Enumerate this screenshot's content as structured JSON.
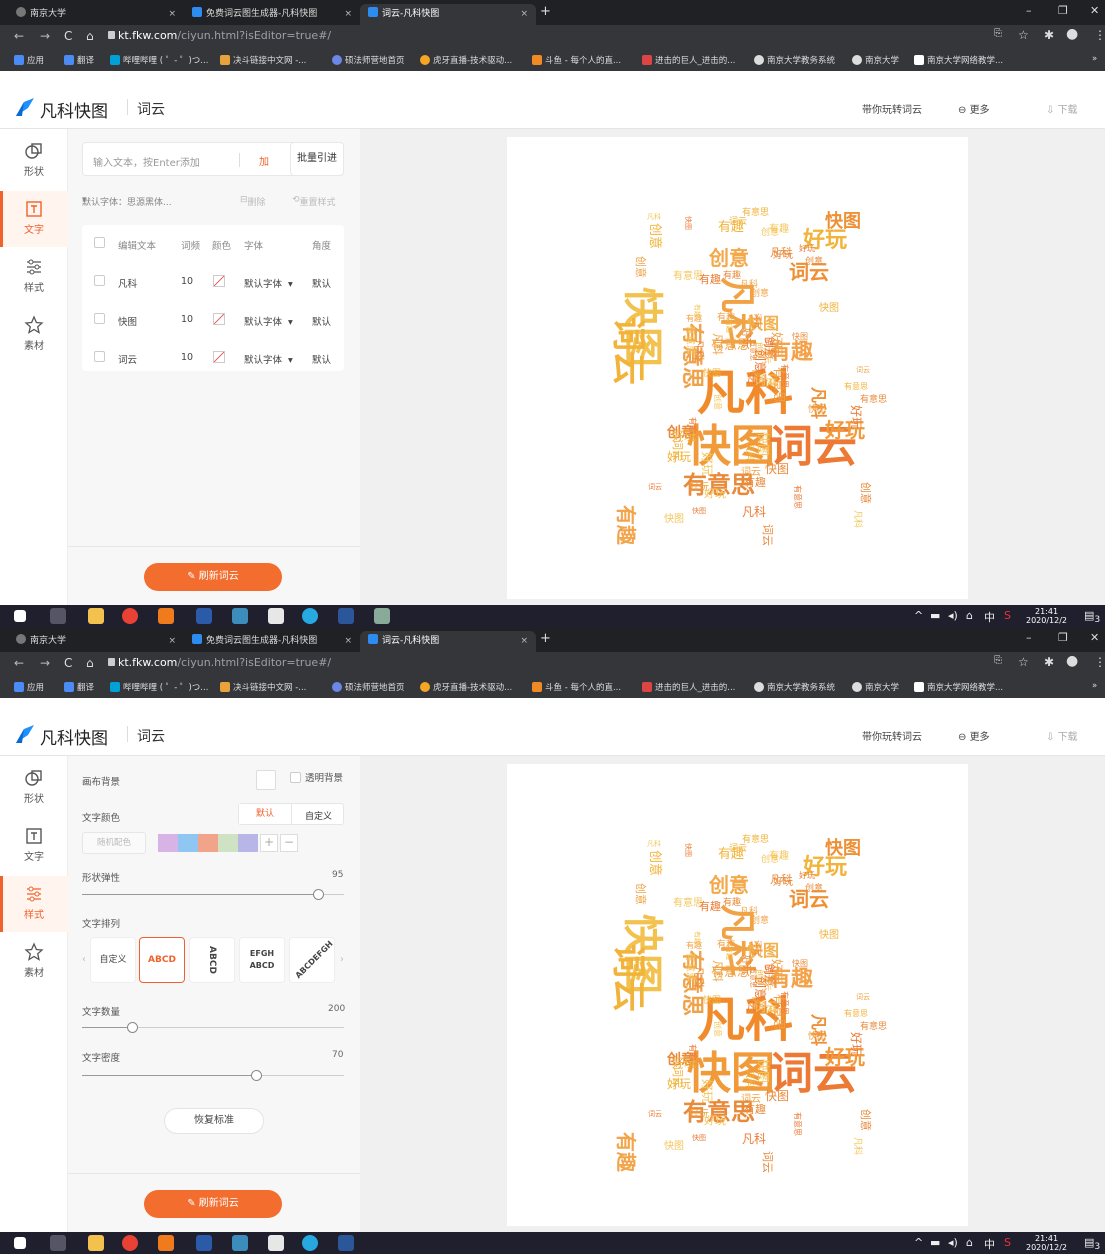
{
  "browser": {
    "tabs": [
      {
        "label": "南京大学",
        "active": false
      },
      {
        "label": "免费词云图生成器-凡科快图",
        "active": false
      },
      {
        "label": "词云-凡科快图",
        "active": true
      }
    ],
    "url_host": "kt.fkw.com",
    "url_path": "/ciyun.html?isEditor=true#/",
    "bookmarks": [
      "应用",
      "翻译",
      "哔哩哔哩 ( ゜- ゜)つ...",
      "决斗链接中文网 -...",
      "硕法师营地首页",
      "虎牙直播-技术驱动...",
      "斗鱼 - 每个人的直...",
      "进击的巨人_进击的...",
      "南京大学教务系统",
      "南京大学",
      "南京大学网络教学..."
    ],
    "more_bookmarks": "»"
  },
  "app": {
    "brand": "凡科快图",
    "section": "词云",
    "header_links": {
      "guide": "带你玩转词云",
      "more": "更多",
      "download": "下载"
    },
    "rail": [
      {
        "label": "形状",
        "icon": "shape-icon"
      },
      {
        "label": "文字",
        "icon": "text-icon"
      },
      {
        "label": "样式",
        "icon": "sliders-icon"
      },
      {
        "label": "素材",
        "icon": "star-icon"
      }
    ],
    "refresh_label": "刷新词云"
  },
  "text_panel": {
    "input_placeholder": "输入文本，按Enter添加",
    "add_label": "加",
    "batch_label": "批量引进",
    "default_font": "默认字体：思源黑体...",
    "delete_label": "删除",
    "reset_style_label": "重置样式",
    "columns": [
      "编辑文本",
      "词频",
      "颜色",
      "字体",
      "角度"
    ],
    "rows": [
      {
        "text": "凡科",
        "freq": "10",
        "font": "默认字体",
        "angle": "默认"
      },
      {
        "text": "快图",
        "freq": "10",
        "font": "默认字体",
        "angle": "默认"
      },
      {
        "text": "词云",
        "freq": "10",
        "font": "默认字体",
        "angle": "默认"
      }
    ]
  },
  "style_panel": {
    "canvas_bg_label": "画布背景",
    "transparent_label": "透明背景",
    "text_color_label": "文字颜色",
    "color_mode_default": "默认",
    "color_mode_custom": "自定义",
    "random_color_label": "随机配色",
    "palette": [
      "#d8b4e6",
      "#8fc6f2",
      "#f2a48a",
      "#cfe2c4",
      "#b7b6e6"
    ],
    "shape_elasticity": {
      "label": "形状弹性",
      "value": 95,
      "max": 100
    },
    "arrangement_label": "文字排列",
    "arrangements": [
      "自定义",
      "ABCD",
      "ABCD",
      "EFGH ABCD",
      "ABCDEFGH"
    ],
    "selected_arrangement": 1,
    "text_count": {
      "label": "文字数量",
      "value": 200,
      "max": 1000
    },
    "text_density": {
      "label": "文字密度",
      "value": 70,
      "max": 100
    },
    "restore_label": "恢复标准"
  },
  "wordcloud": {
    "big_words": [
      "凡科",
      "快图",
      "词云",
      "有意思",
      "有趣",
      "好玩",
      "创意"
    ],
    "small_words": [
      "凡科",
      "快图",
      "词云",
      "有趣",
      "好玩",
      "创意",
      "有意思"
    ]
  },
  "taskbar": {
    "time": "21:41",
    "date": "2020/12/2",
    "ime": "中",
    "notify_count": "3"
  }
}
